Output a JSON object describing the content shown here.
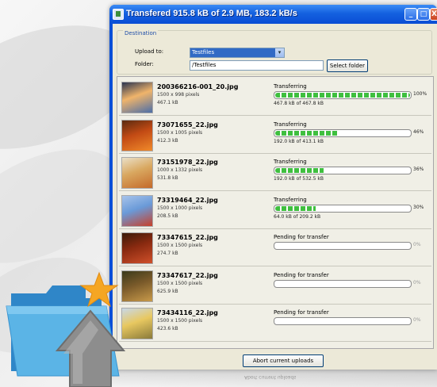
{
  "window": {
    "title": "Transfered 915.8 kB of 2.9 MB, 183.2 kB/s",
    "controls": {
      "minimize": "_",
      "maximize": "□",
      "close": "X"
    }
  },
  "destination": {
    "group_label": "Destination",
    "upload_to_label": "Upload to:",
    "upload_to_value": "Testfiles",
    "folder_label": "Folder:",
    "folder_value": "/Testfiles",
    "select_folder_label": "Select folder"
  },
  "files": [
    {
      "name": "200366216-001_20.jpg",
      "dimensions": "1500 x 998 pixels",
      "size": "467.1 kB",
      "status": "Transferring",
      "percent_label": "100%",
      "progress": 1.0,
      "bytes": "467.8 kB of 467.8 kB",
      "thumb": "mountain-sunset",
      "colors": [
        "#f0b46a",
        "#4b6ea8",
        "#2a3550"
      ]
    },
    {
      "name": "73071655_22.jpg",
      "dimensions": "1500 x 1005 pixels",
      "size": "412.3 kB",
      "status": "Transferring",
      "percent_label": "46%",
      "progress": 0.46,
      "bytes": "192.0 kB of 413.1 kB",
      "thumb": "autumn-leaves-orange",
      "colors": [
        "#c24a14",
        "#f08a2a",
        "#5a2a10"
      ]
    },
    {
      "name": "73151978_22.jpg",
      "dimensions": "1000 x 1332 pixels",
      "size": "531.8 kB",
      "status": "Transferring",
      "percent_label": "36%",
      "progress": 0.36,
      "bytes": "192.0 kB of 532.5 kB",
      "thumb": "autumn-tree",
      "colors": [
        "#d9a860",
        "#c46a2a",
        "#eae0c8"
      ]
    },
    {
      "name": "73319464_22.jpg",
      "dimensions": "1500 x 1000 pixels",
      "size": "208.5 kB",
      "status": "Transferring",
      "percent_label": "30%",
      "progress": 0.3,
      "bytes": "64.0 kB of 209.2 kB",
      "thumb": "red-leaves-sky",
      "colors": [
        "#6a9ad8",
        "#c8402a",
        "#a8c4ea"
      ]
    },
    {
      "name": "73347615_22.jpg",
      "dimensions": "1500 x 1500 pixels",
      "size": "274.7 kB",
      "status": "Pending for transfer",
      "percent_label": "0%",
      "progress": 0,
      "bytes": "",
      "thumb": "red-leaf-dark",
      "colors": [
        "#8a2a10",
        "#d0502a",
        "#3a1a08"
      ]
    },
    {
      "name": "73347617_22.jpg",
      "dimensions": "1500 x 1500 pixels",
      "size": "625.9 kB",
      "status": "Pending for transfer",
      "percent_label": "0%",
      "progress": 0,
      "bytes": "",
      "thumb": "forest-autumn",
      "colors": [
        "#7a5a2a",
        "#c89a4a",
        "#3a3a1a"
      ]
    },
    {
      "name": "73434116_22.jpg",
      "dimensions": "1500 x 1500 pixels",
      "size": "423.6 kB",
      "status": "Pending for transfer",
      "percent_label": "0%",
      "progress": 0,
      "bytes": "",
      "thumb": "yellow-trees",
      "colors": [
        "#e8c860",
        "#8a7a3a",
        "#c8d8e8"
      ]
    }
  ],
  "abort_label": "Abort current uploads",
  "reflection_text": "Abort current uploads",
  "colors": {
    "titlebar": "#0a4fd8",
    "client": "#ece9d8",
    "progress_fill": "#3fbf3f",
    "folder": "#5bb4e6",
    "star": "#f5a623",
    "arrow": "#8a8a8a"
  },
  "decor": {
    "folder_icon": "upload-folder-icon",
    "star_icon": "star-icon",
    "arrow_icon": "up-arrow-icon"
  }
}
